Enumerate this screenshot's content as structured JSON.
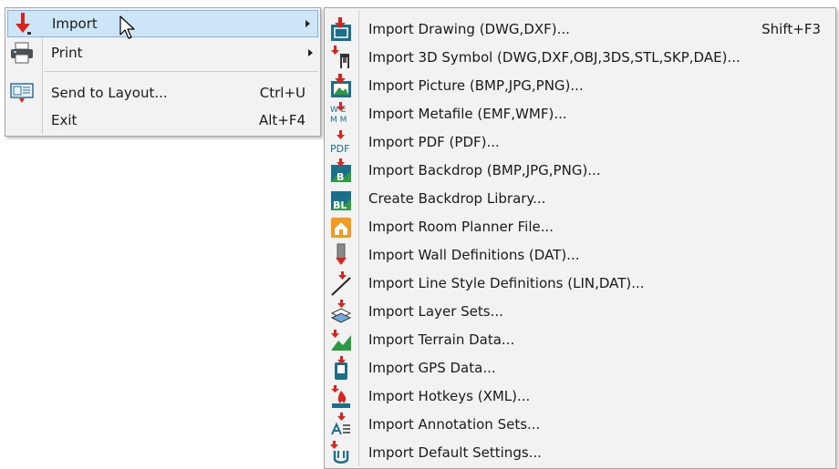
{
  "main_menu": {
    "items": [
      {
        "label": "Import",
        "icon": "import-arrow-icon",
        "has_submenu": true,
        "shortcut": ""
      },
      {
        "label": "Print",
        "icon": "printer-icon",
        "has_submenu": true,
        "shortcut": ""
      },
      {
        "label": "Send to Layout...",
        "icon": "send-to-layout-icon",
        "has_submenu": false,
        "shortcut": "Ctrl+U"
      },
      {
        "label": "Exit",
        "icon": "",
        "has_submenu": false,
        "shortcut": "Alt+F4"
      }
    ]
  },
  "import_submenu": {
    "items": [
      {
        "label": "Import Drawing (DWG,DXF)...",
        "shortcut": "Shift+F3",
        "icon": "import-drawing-icon"
      },
      {
        "label": "Import 3D Symbol (DWG,DXF,OBJ,3DS,STL,SKP,DAE)...",
        "shortcut": "",
        "icon": "import-3d-symbol-icon"
      },
      {
        "label": "Import Picture (BMP,JPG,PNG)...",
        "shortcut": "",
        "icon": "import-picture-icon"
      },
      {
        "label": "Import Metafile (EMF,WMF)...",
        "shortcut": "",
        "icon": "import-metafile-icon"
      },
      {
        "label": "Import PDF (PDF)...",
        "shortcut": "",
        "icon": "import-pdf-icon"
      },
      {
        "label": "Import Backdrop (BMP,JPG,PNG)...",
        "shortcut": "",
        "icon": "import-backdrop-icon"
      },
      {
        "label": "Create Backdrop Library...",
        "shortcut": "",
        "icon": "backdrop-library-icon"
      },
      {
        "label": "Import Room Planner File...",
        "shortcut": "",
        "icon": "room-planner-icon"
      },
      {
        "label": "Import Wall Definitions (DAT)...",
        "shortcut": "",
        "icon": "wall-definitions-icon"
      },
      {
        "label": "Import Line Style Definitions (LIN,DAT)...",
        "shortcut": "",
        "icon": "line-style-icon"
      },
      {
        "label": "Import Layer Sets...",
        "shortcut": "",
        "icon": "layer-sets-icon"
      },
      {
        "label": "Import Terrain Data...",
        "shortcut": "",
        "icon": "terrain-icon"
      },
      {
        "label": "Import GPS Data...",
        "shortcut": "",
        "icon": "gps-icon"
      },
      {
        "label": "Import Hotkeys (XML)...",
        "shortcut": "",
        "icon": "hotkeys-icon"
      },
      {
        "label": "Import Annotation Sets...",
        "shortcut": "",
        "icon": "annotation-sets-icon"
      },
      {
        "label": "Import Default Settings...",
        "shortcut": "",
        "icon": "default-settings-icon"
      }
    ]
  },
  "icon_text": {
    "metafile_top": "W E",
    "metafile_bottom": "M M",
    "pdf": "PDF",
    "backdrop": "B",
    "backdrop_library": "BL"
  },
  "colors": {
    "menu_bg": "#f2f2f2",
    "highlight_bg": "#cde6f7",
    "highlight_border": "#7eb4ea",
    "import_arrow": "#d9231c",
    "icon_teal": "#1c6f8a",
    "icon_green": "#2f9a44"
  }
}
